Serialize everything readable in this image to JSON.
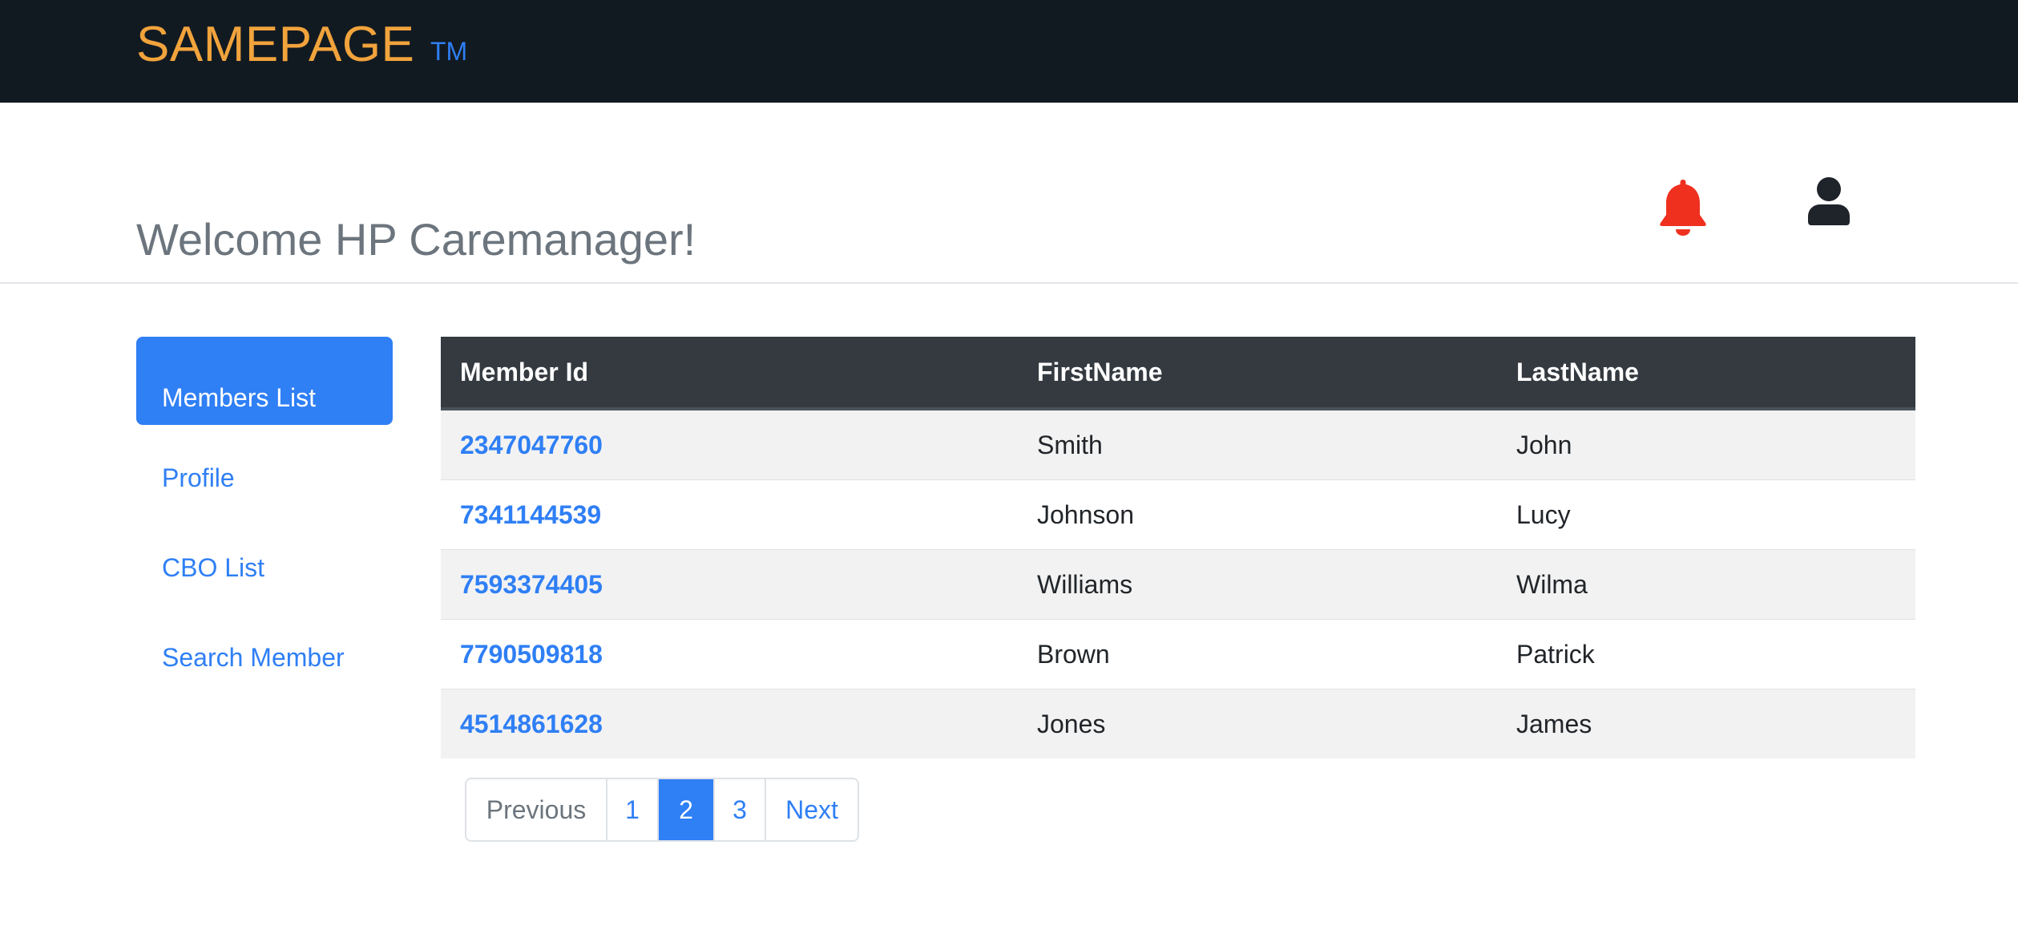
{
  "header": {
    "brand": "SAMEPAGE",
    "trademark": "TM",
    "brand_color": "#f1a33c"
  },
  "welcome": {
    "text": "Welcome HP Caremanager!",
    "notification_icon": "bell-icon",
    "notification_color": "#f0301f",
    "user_icon": "user-icon"
  },
  "sidebar": {
    "items": [
      {
        "label": "Members List",
        "active": true
      },
      {
        "label": "Profile",
        "active": false
      },
      {
        "label": "CBO List",
        "active": false
      },
      {
        "label": "Search Member",
        "active": false
      }
    ]
  },
  "table": {
    "columns": [
      "Member Id",
      "FirstName",
      "LastName"
    ],
    "rows": [
      {
        "member_id": "2347047760",
        "first": "Smith",
        "last": "John"
      },
      {
        "member_id": "7341144539",
        "first": "Johnson",
        "last": "Lucy"
      },
      {
        "member_id": "7593374405",
        "first": "Williams",
        "last": "Wilma"
      },
      {
        "member_id": "7790509818",
        "first": "Brown",
        "last": "Patrick"
      },
      {
        "member_id": "4514861628",
        "first": "Jones",
        "last": "James"
      }
    ]
  },
  "pagination": {
    "previous_label": "Previous",
    "pages": [
      "1",
      "2",
      "3"
    ],
    "current_page": "2",
    "next_label": "Next"
  },
  "colors": {
    "accent": "#2f7ff5",
    "topbar": "#121a21",
    "table_header": "#343a40"
  }
}
